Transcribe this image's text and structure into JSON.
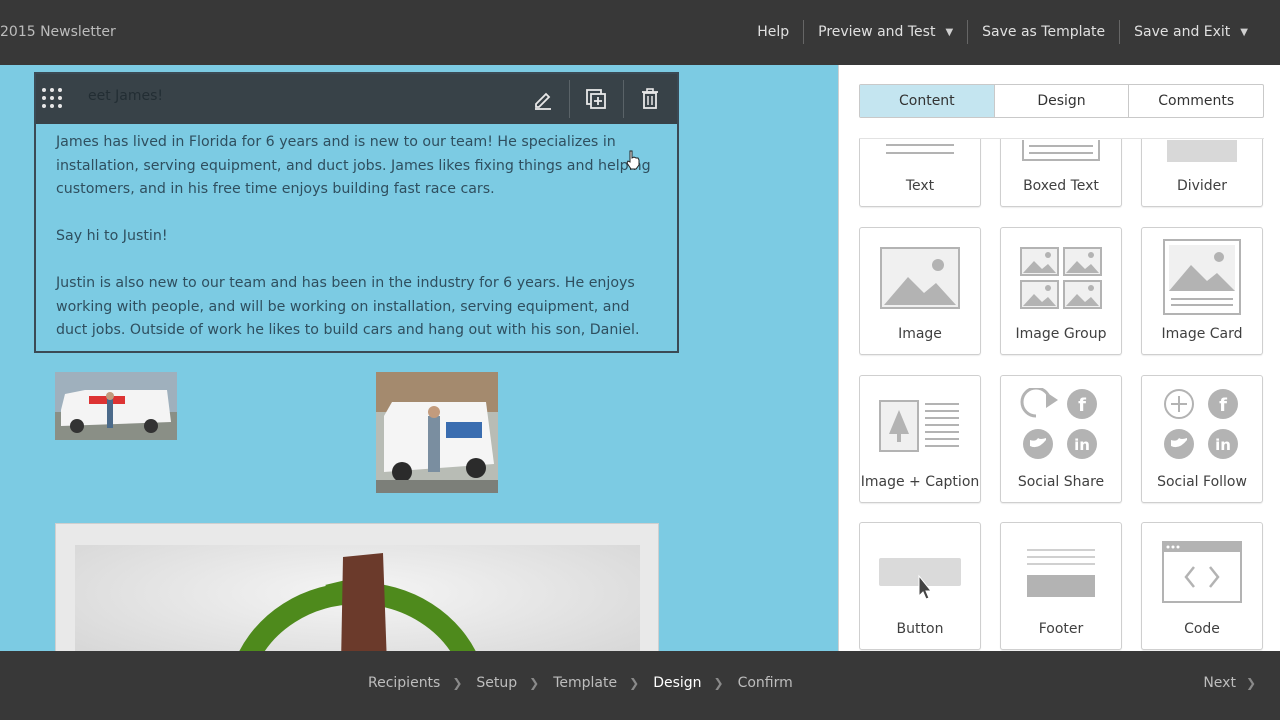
{
  "header": {
    "title": "2015 Newsletter",
    "help": "Help",
    "preview": "Preview and Test",
    "save_template": "Save as Template",
    "save_exit": "Save and Exit"
  },
  "block": {
    "ghost_text": "eet James!",
    "paragraphs": [
      "James has lived in Florida for 6 years and is new to our team! He specializes in installation, serving equipment, and duct jobs. James likes fixing things and helping customers, and in his free time enjoys building fast race cars.",
      "Say hi to Justin!",
      "Justin is also new to our team and has been in the industry for 6 years. He enjoys working with people, and will be working on installation, serving equipment, and duct jobs. Outside of work he likes to build cars and hang out with his son, Daniel."
    ],
    "toolbar_icons": [
      "edit-icon",
      "duplicate-icon",
      "trash-icon"
    ]
  },
  "panel": {
    "tabs": [
      "Content",
      "Design",
      "Comments"
    ],
    "active_tab": "Content",
    "tiles": [
      "Text",
      "Boxed Text",
      "Divider",
      "Image",
      "Image Group",
      "Image Card",
      "Image + Caption",
      "Social Share",
      "Social Follow",
      "Button",
      "Footer",
      "Code"
    ]
  },
  "footer_nav": {
    "steps": [
      "Recipients",
      "Setup",
      "Template",
      "Design",
      "Confirm"
    ],
    "active_step": "Design",
    "next": "Next"
  },
  "colors": {
    "canvas_bg": "#7ccbe3",
    "bar_bg": "#383838",
    "active_tab_bg": "#c4e5f0",
    "icon_gray": "#b3b3b3"
  }
}
